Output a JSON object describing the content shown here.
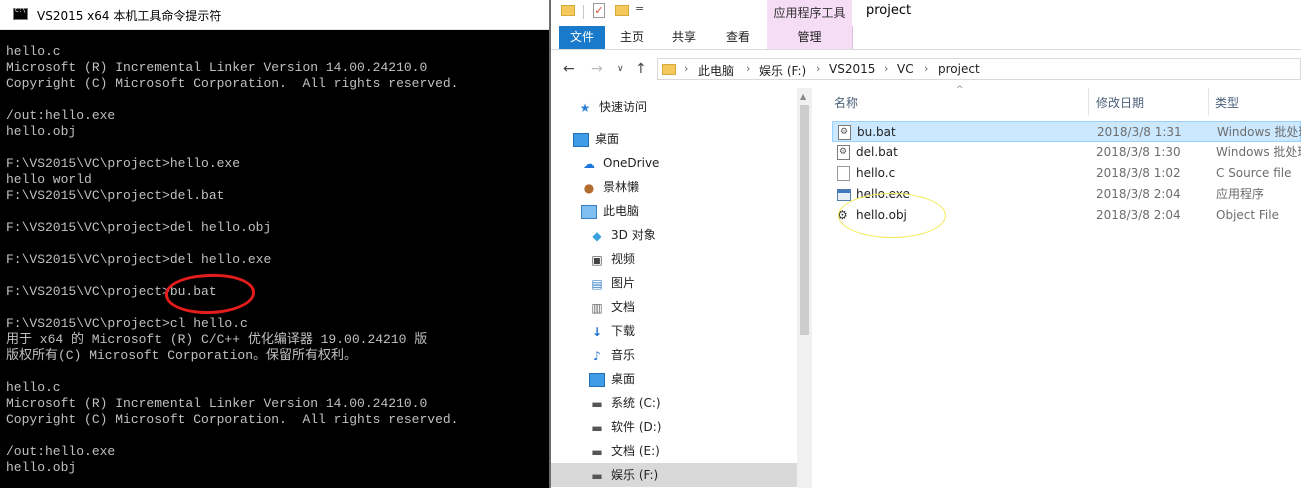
{
  "console": {
    "title": "VS2015 x64 本机工具命令提示符",
    "lines": [
      "hello.c",
      "Microsoft (R) Incremental Linker Version 14.00.24210.0",
      "Copyright (C) Microsoft Corporation.  All rights reserved.",
      "",
      "/out:hello.exe",
      "hello.obj",
      "",
      "F:\\VS2015\\VC\\project>hello.exe",
      "hello world",
      "F:\\VS2015\\VC\\project>del.bat",
      "",
      "F:\\VS2015\\VC\\project>del hello.obj",
      "",
      "F:\\VS2015\\VC\\project>del hello.exe",
      "",
      "F:\\VS2015\\VC\\project>bu.bat",
      "",
      "F:\\VS2015\\VC\\project>cl hello.c",
      "用于 x64 的 Microsoft (R) C/C++ 优化编译器 19.00.24210 版",
      "版权所有(C) Microsoft Corporation。保留所有权利。",
      "",
      "hello.c",
      "Microsoft (R) Incremental Linker Version 14.00.24210.0",
      "Copyright (C) Microsoft Corporation.  All rights reserved.",
      "",
      "/out:hello.exe",
      "hello.obj"
    ]
  },
  "explorer": {
    "window_title": "project",
    "context_tab_header": "应用程序工具",
    "ribbon_tabs": {
      "file": "文件",
      "home": "主页",
      "share": "共享",
      "view": "查看",
      "manage": "管理"
    },
    "breadcrumb": [
      "此电脑",
      "娱乐 (F:)",
      "VS2015",
      "VC",
      "project"
    ],
    "nav_items": [
      {
        "label": "快速访问",
        "icon": "star-icon"
      },
      {
        "label": "桌面",
        "icon": "desktop-icon"
      },
      {
        "label": "OneDrive",
        "icon": "cloud-icon"
      },
      {
        "label": "景林懒",
        "icon": "user-icon"
      },
      {
        "label": "此电脑",
        "icon": "computer-icon"
      },
      {
        "label": "3D 对象",
        "icon": "cube-icon"
      },
      {
        "label": "视频",
        "icon": "video-icon"
      },
      {
        "label": "图片",
        "icon": "picture-icon"
      },
      {
        "label": "文档",
        "icon": "document-icon"
      },
      {
        "label": "下载",
        "icon": "download-icon"
      },
      {
        "label": "音乐",
        "icon": "music-icon"
      },
      {
        "label": "桌面",
        "icon": "desktop-icon"
      },
      {
        "label": "系统 (C:)",
        "icon": "drive-icon"
      },
      {
        "label": "软件 (D:)",
        "icon": "drive-icon"
      },
      {
        "label": "文档 (E:)",
        "icon": "drive-icon"
      },
      {
        "label": "娱乐 (F:)",
        "icon": "drive-icon"
      }
    ],
    "columns": {
      "name": "名称",
      "date": "修改日期",
      "type": "类型"
    },
    "files": [
      {
        "name": "bu.bat",
        "date": "2018/3/8 1:31",
        "type": "Windows 批处理",
        "icon": "batch-file-icon",
        "selected": true
      },
      {
        "name": "del.bat",
        "date": "2018/3/8 1:30",
        "type": "Windows 批处理",
        "icon": "batch-file-icon",
        "selected": false
      },
      {
        "name": "hello.c",
        "date": "2018/3/8 1:02",
        "type": "C Source file",
        "icon": "c-file-icon",
        "selected": false
      },
      {
        "name": "hello.exe",
        "date": "2018/3/8 2:04",
        "type": "应用程序",
        "icon": "exe-file-icon",
        "selected": false
      },
      {
        "name": "hello.obj",
        "date": "2018/3/8 2:04",
        "type": "Object File",
        "icon": "obj-file-icon",
        "selected": false
      }
    ]
  },
  "colors": {
    "console_bg": "#000000",
    "console_text": "#c0c0c0",
    "annotation_red": "#e31c1c",
    "annotation_yellow": "#f0ea50",
    "selection_bg": "#cce8ff",
    "file_tab": "#1979ca",
    "context_tab": "#f6ddf6"
  }
}
